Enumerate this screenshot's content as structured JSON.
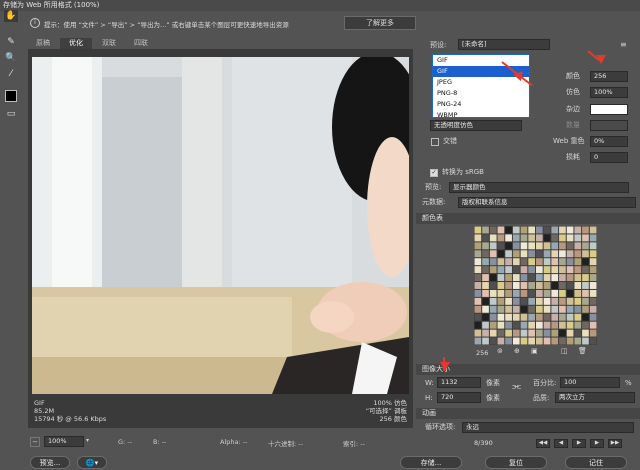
{
  "window": {
    "title": "存储为 Web 所用格式 (100%)"
  },
  "tip": {
    "icon": "info-icon",
    "text": "提示：使用 “文件” > “导出” > “导出为...” 或右键单击某个图层可更快速地导出资源",
    "button": "了解更多"
  },
  "tabs": [
    "原稿",
    "优化",
    "双联",
    "四联"
  ],
  "active_tab": "优化",
  "image_info": {
    "format": "GIF",
    "size": "85.2M",
    "time": "15794 秒 @ 56.6 Kbps",
    "zoom_pct": "100% 仿色",
    "palette_type": "“可选择” 调板",
    "colors": "256 颜色"
  },
  "status": {
    "zoom": "100%",
    "r": "R: --",
    "g": "G: --",
    "b": "B: --",
    "alpha": "Alpha: --",
    "hex": "十六进制: --",
    "index": "索引: --"
  },
  "settings": {
    "preset_label": "预设:",
    "preset_value": "[未命名]",
    "format_value": "GIF",
    "format_options": [
      "GIF",
      "JPEG",
      "PNG-8",
      "PNG-24",
      "WBMP"
    ],
    "colors_label": "颜色",
    "colors_value": "256",
    "dither_label": "仿色",
    "dither_value": "100%",
    "matte_label": "杂边",
    "amount_label": "数量",
    "web_snap_label": "Web 靠色",
    "web_snap_value": "0%",
    "lossy_label": "损耗",
    "lossy_value": "0",
    "transparency_dither": "无透明度仿色",
    "interlaced_label": "交错",
    "convert_srgb": "转换为 sRGB",
    "preview_label": "预览:",
    "preview_value": "显示器颜色",
    "metadata_label": "元数据:",
    "metadata_value": "版权和联系信息"
  },
  "color_table": {
    "title": "颜色表",
    "count": "256"
  },
  "image_size": {
    "title": "图像大小",
    "w_label": "W:",
    "w_value": "1132",
    "h_label": "H:",
    "h_value": "720",
    "unit": "像素",
    "percent_label": "百分比:",
    "percent_value": "100",
    "percent_unit": "%",
    "quality_label": "品质:",
    "quality_value": "两次立方"
  },
  "animation": {
    "title": "动画",
    "loop_label": "循环选项:",
    "loop_value": "永远",
    "frame": "8/390"
  },
  "footer": {
    "preview": "预览...",
    "save": "存储...",
    "reset": "复位",
    "remember": "记住"
  },
  "colors": {
    "accent_red": "#e6392b",
    "dropdown_selected": "#1c5fcf"
  }
}
